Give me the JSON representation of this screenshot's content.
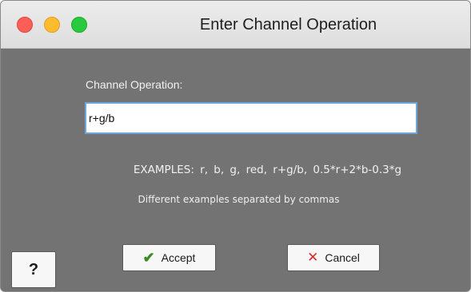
{
  "window": {
    "title": "Enter Channel Operation"
  },
  "form": {
    "operation_label": "Channel Operation:",
    "operation_value": "r+g/b"
  },
  "examples": {
    "text": "EXAMPLES:  r,  b,  g,  red,  r+g/b,  0.5*r+2*b-0.3*g",
    "hint": "Different examples separated by commas"
  },
  "buttons": {
    "accept_label": "Accept",
    "accept_icon": "✔",
    "cancel_label": "Cancel",
    "cancel_icon": "✕",
    "help_label": "?"
  },
  "colors": {
    "background": "#737373",
    "close": "#fc5f57",
    "minimize": "#fdbc2e",
    "maximize": "#29c940",
    "input_focus": "#6fa5dc",
    "accept_icon": "#3c8a24",
    "cancel_icon": "#d92b2b"
  },
  "icons": [
    "close-icon",
    "minimize-icon",
    "maximize-icon",
    "check-icon",
    "x-icon"
  ]
}
